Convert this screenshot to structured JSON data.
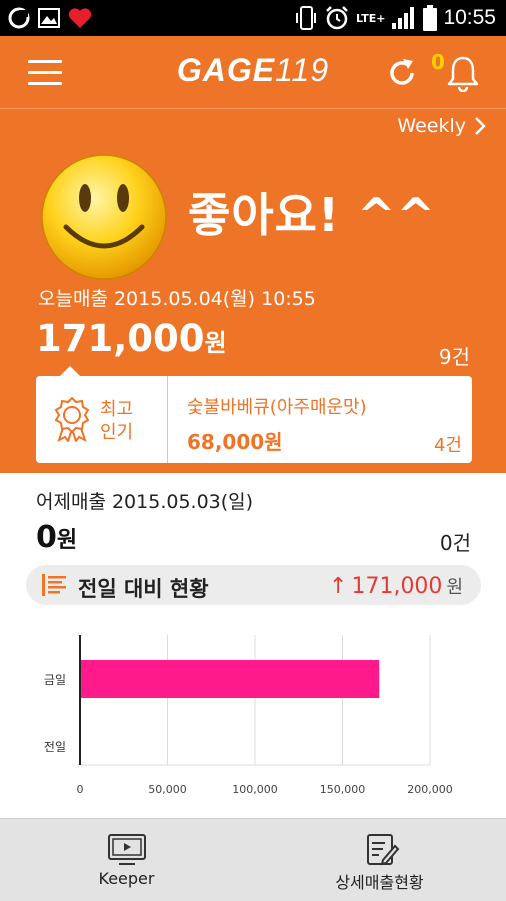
{
  "status_bar": {
    "time": "10:55",
    "network": "LTE+",
    "icons": [
      "app-circle-icon",
      "image-icon",
      "heart-icon",
      "phone-vibrate-icon",
      "alarm-icon",
      "signal-icon",
      "battery-icon"
    ]
  },
  "header": {
    "logo_bold": "GAGE",
    "logo_num": "119",
    "notification_count": "0",
    "icons": [
      "menu-icon",
      "refresh-icon",
      "bell-icon"
    ]
  },
  "period_selector": {
    "label": "Weekly"
  },
  "mood": {
    "headline": "좋아요! ^^",
    "icon": "smiley-face-icon"
  },
  "today": {
    "label": "오늘매출",
    "datetime": "2015.05.04(월) 10:55",
    "amount": "171,000",
    "unit": "원",
    "count": "9건"
  },
  "best_item": {
    "badge_line1": "최고",
    "badge_line2": "인기",
    "name": "숯불바베큐(아주매운맛)",
    "price": "68,000원",
    "count": "4건"
  },
  "yesterday": {
    "label": "어제매출",
    "datetime": "2015.05.03(일)",
    "amount": "0",
    "unit": "원",
    "count": "0건"
  },
  "comparison": {
    "label": "전일 대비 현황",
    "arrow": "↑",
    "value": "171,000",
    "unit": "원"
  },
  "chart_data": {
    "type": "bar",
    "orientation": "horizontal",
    "categories": [
      "금일",
      "전일"
    ],
    "values": [
      171000,
      0
    ],
    "xlim": [
      0,
      200000
    ],
    "xticks": [
      0,
      50000,
      100000,
      150000,
      200000
    ],
    "xtick_labels": [
      "0",
      "50,000",
      "100,000",
      "150,000",
      "200,000"
    ],
    "bar_color": "#ff1a8c",
    "grid": true
  },
  "bottom_nav": [
    {
      "label": "Keeper",
      "icon": "tv-icon"
    },
    {
      "label": "상세매출현황",
      "icon": "document-edit-icon"
    }
  ],
  "colors": {
    "brand_orange": "#ee7427",
    "accent_yellow": "#ffd000",
    "up_red": "#e53b36"
  }
}
